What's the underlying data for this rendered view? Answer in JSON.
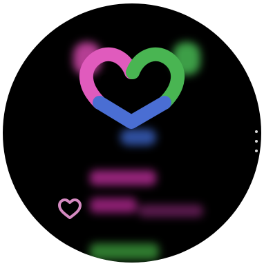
{
  "screen": {
    "title": "",
    "placeholder_text": ""
  },
  "colors": {
    "pink": "#e05bbd",
    "green": "#49b552",
    "blue": "#4a6ed3",
    "blurred_text_pink": "#95247a",
    "blurred_text_green": "#2f7a2f",
    "background": "#000000"
  },
  "icons": {
    "main_heart": "activity-heart-icon",
    "small_heart": "heart-outline-icon",
    "menu": "more-options-icon"
  }
}
